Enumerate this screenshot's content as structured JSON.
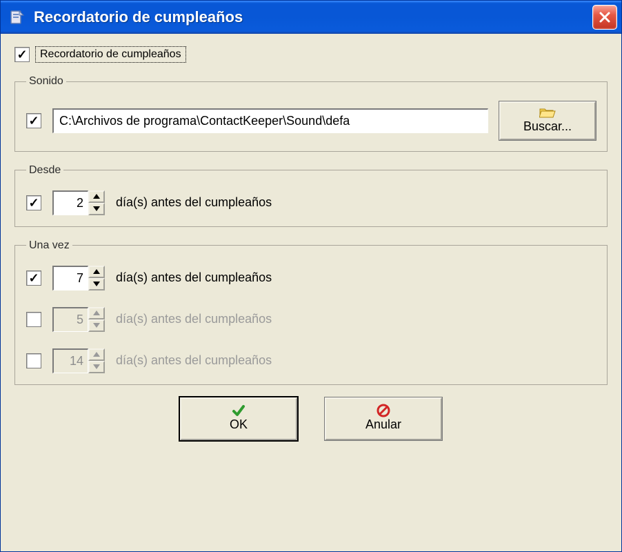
{
  "window": {
    "title": "Recordatorio de cumpleaños"
  },
  "main_checkbox": {
    "label": "Recordatorio de cumpleaños",
    "checked": true
  },
  "sound": {
    "legend": "Sonido",
    "checked": true,
    "path": "C:\\Archivos de programa\\ContactKeeper\\Sound\\defa",
    "browse_label": "Buscar..."
  },
  "desde": {
    "legend": "Desde",
    "row": {
      "checked": true,
      "value": "2",
      "suffix": "día(s) antes del cumpleaños",
      "enabled": true
    }
  },
  "una_vez": {
    "legend": "Una vez",
    "rows": [
      {
        "checked": true,
        "value": "7",
        "suffix": "día(s) antes del cumpleaños",
        "enabled": true
      },
      {
        "checked": false,
        "value": "5",
        "suffix": "día(s) antes del cumpleaños",
        "enabled": false
      },
      {
        "checked": false,
        "value": "14",
        "suffix": "día(s) antes del cumpleaños",
        "enabled": false
      }
    ]
  },
  "buttons": {
    "ok": "OK",
    "cancel": "Anular"
  }
}
